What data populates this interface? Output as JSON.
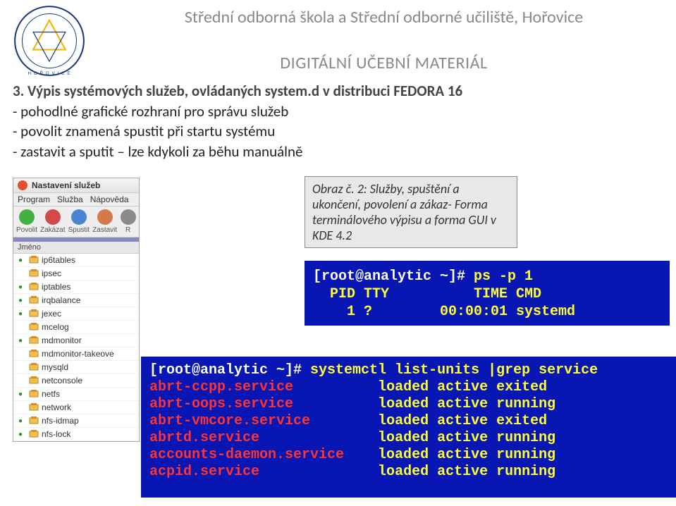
{
  "header": {
    "school_name": "Střední odborná škola a Střední odborné učiliště, Hořovice",
    "subtitle": "DIGITÁLNÍ UČEBNÍ MATERIÁL"
  },
  "section": {
    "number_title": "3.  Výpis systémových služeb, ovládaných system.d v  distribuci FEDORA 16",
    "lines": [
      "- pohodlné grafické rozhraní pro správu služeb",
      "- povolit znamená spustit při startu systému",
      "- zastavit a sputit – lze kdykoli za běhu manuálně"
    ]
  },
  "gui": {
    "title": "Nastavení služeb",
    "menus": {
      "m1": "Program",
      "m2": "Služba",
      "m3": "Nápověda"
    },
    "toolbar": {
      "b1": "Povolit",
      "b2": "Zakázat",
      "b3": "Spustit",
      "b4": "Zastavit",
      "b5": "R"
    },
    "col_header": "Jméno",
    "services": [
      {
        "name": "ip6tables",
        "on": true
      },
      {
        "name": "ipsec",
        "on": false
      },
      {
        "name": "iptables",
        "on": true
      },
      {
        "name": "irqbalance",
        "on": true
      },
      {
        "name": "jexec",
        "on": true
      },
      {
        "name": "mcelog",
        "on": false
      },
      {
        "name": "mdmonitor",
        "on": true
      },
      {
        "name": "mdmonitor-takeove",
        "on": false
      },
      {
        "name": "mysqld",
        "on": false
      },
      {
        "name": "netconsole",
        "on": false
      },
      {
        "name": "netfs",
        "on": true
      },
      {
        "name": "network",
        "on": false
      },
      {
        "name": "nfs-idmap",
        "on": true
      },
      {
        "name": "nfs-lock",
        "on": true
      }
    ]
  },
  "caption": {
    "label": "Obraz č. 2:",
    "text": "Služby, spuštění a ukončení, povolení a zákaz- Forma terminálového výpisu a forma GUI v KDE 4.2"
  },
  "term1": {
    "prompt": "[root@analytic ~]# ",
    "cmd": "ps -p 1",
    "out_header": "  PID TTY          TIME CMD",
    "out_row": "    1 ?        00:00:01 systemd"
  },
  "term2": {
    "prompt": "[root@analytic ~]# ",
    "cmd": "systemctl list-units |grep service",
    "rows": [
      {
        "svc": "abrt-ccpp.service",
        "rest": "          loaded active exited"
      },
      {
        "svc": "abrt-oops.service",
        "rest": "          loaded active running"
      },
      {
        "svc": "abrt-vmcore.service",
        "rest": "        loaded active exited"
      },
      {
        "svc": "abrtd.service",
        "rest": "              loaded active running"
      },
      {
        "svc": "accounts-daemon.service",
        "rest": "    loaded active running"
      },
      {
        "svc": "acpid.service",
        "rest": "              loaded active running"
      }
    ]
  }
}
